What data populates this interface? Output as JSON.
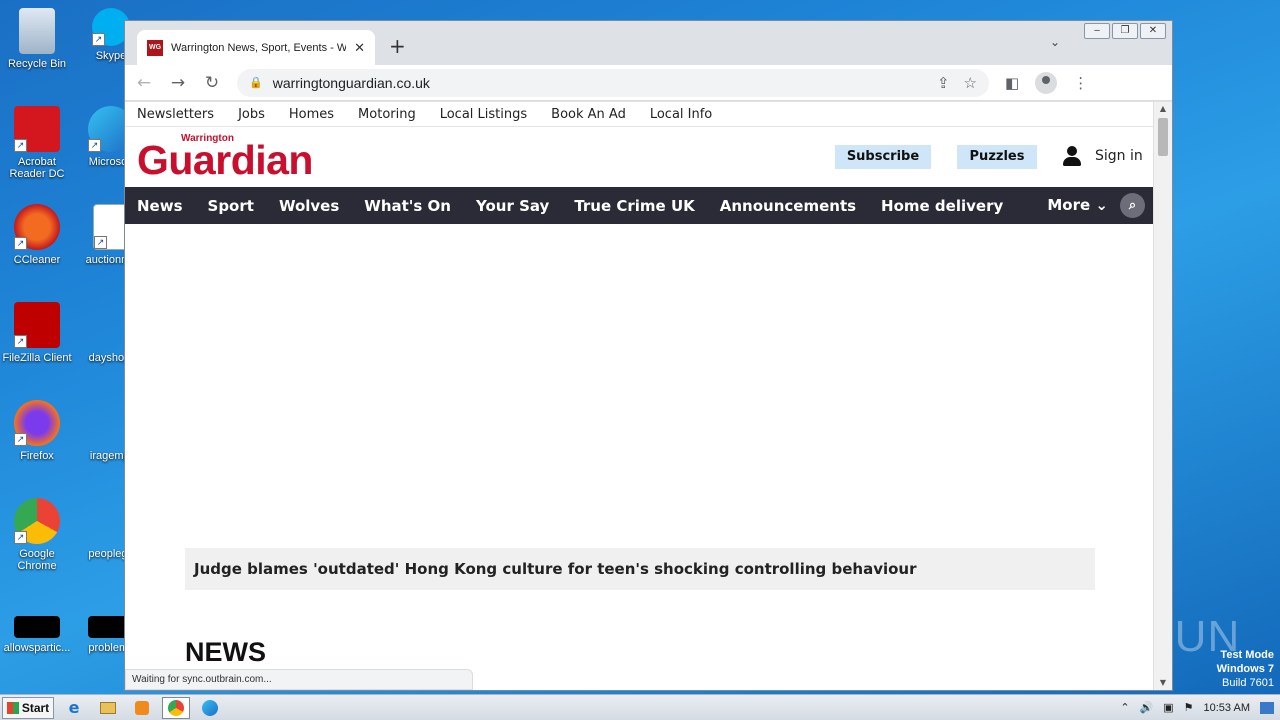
{
  "desktop": {
    "icons": [
      {
        "label": "Recycle Bin"
      },
      {
        "label": "Skype"
      },
      {
        "label": "Acrobat Reader DC"
      },
      {
        "label": "Microsoft"
      },
      {
        "label": "CCleaner"
      },
      {
        "label": "auctionme"
      },
      {
        "label": "FileZilla Client"
      },
      {
        "label": "dayshop."
      },
      {
        "label": "Firefox"
      },
      {
        "label": "iragempl"
      },
      {
        "label": "Google Chrome"
      },
      {
        "label": "peoplege"
      },
      {
        "label": "allowspartic..."
      },
      {
        "label": "problems"
      }
    ],
    "watermark": "ANY RUN",
    "testmode": {
      "line1": "Test Mode",
      "line2": "Windows 7",
      "line3": "Build 7601"
    }
  },
  "browser": {
    "tab": {
      "favicon": "WG",
      "title": "Warrington News, Sport, Events - W",
      "close": "✕"
    },
    "newtab": "+",
    "omnibox": {
      "url": "warringtonguardian.co.uk"
    },
    "status": "Waiting for sync.outbrain.com..."
  },
  "site": {
    "util_nav": [
      "Newsletters",
      "Jobs",
      "Homes",
      "Motoring",
      "Local Listings",
      "Book An Ad",
      "Local Info"
    ],
    "logo": {
      "small": "Warrington",
      "big": "Guardian"
    },
    "subscribe": "Subscribe",
    "puzzles": "Puzzles",
    "sign_in": "Sign in",
    "main_nav": [
      "News",
      "Sport",
      "Wolves",
      "What's On",
      "Your Say",
      "True Crime UK",
      "Announcements",
      "Home delivery"
    ],
    "more": "More",
    "headline": "Judge blames 'outdated' Hong Kong culture for teen's shocking controlling behaviour",
    "section_title": "NEWS"
  },
  "taskbar": {
    "start": "Start",
    "clock": "10:53 AM"
  },
  "colors": {
    "brand_red": "#c8102e",
    "nav_bg": "#2b2b37",
    "pill_bg": "#cfe6f8"
  }
}
